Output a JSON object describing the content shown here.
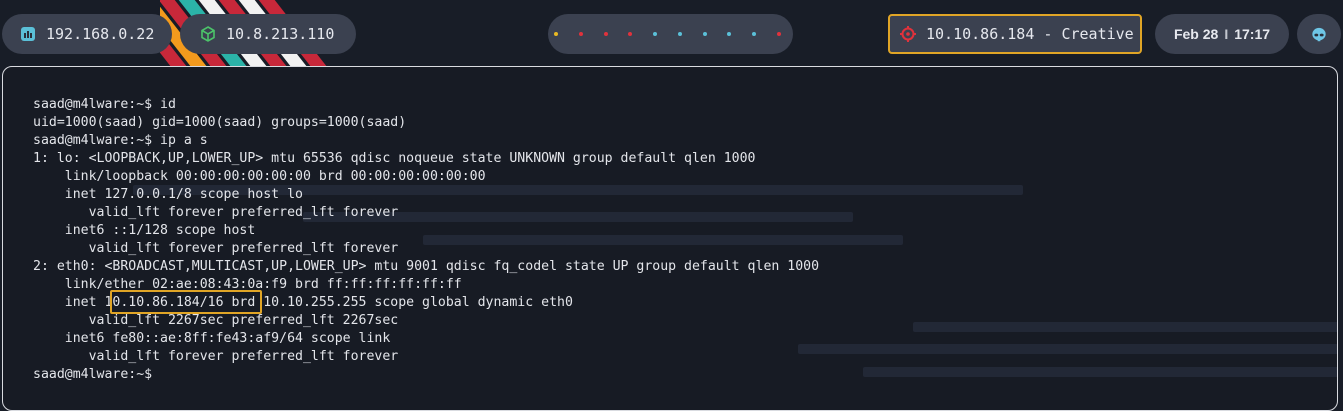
{
  "topbar": {
    "ip_local": "192.168.0.22",
    "ip_vpn": "10.8.213.110",
    "workspace_dots": [
      "#e8b923",
      "#e0323c",
      "#e0323c",
      "#e0323c",
      "#5bc0d8",
      "#5bc0d8",
      "#5bc0d8",
      "#5bc0d8",
      "#5bc0d8",
      "#e0323c"
    ],
    "target": "10.10.86.184 - Creative",
    "clock_date": "Feb 28",
    "clock_sep": "I",
    "clock_time": "17:17"
  },
  "terminal": {
    "lines": [
      "saad@m4lware:~$ id",
      "uid=1000(saad) gid=1000(saad) groups=1000(saad)",
      "saad@m4lware:~$ ip a s",
      "1: lo: <LOOPBACK,UP,LOWER_UP> mtu 65536 qdisc noqueue state UNKNOWN group default qlen 1000",
      "    link/loopback 00:00:00:00:00:00 brd 00:00:00:00:00:00",
      "    inet 127.0.0.1/8 scope host lo",
      "       valid_lft forever preferred_lft forever",
      "    inet6 ::1/128 scope host",
      "       valid_lft forever preferred_lft forever",
      "2: eth0: <BROADCAST,MULTICAST,UP,LOWER_UP> mtu 9001 qdisc fq_codel state UP group default qlen 1000",
      "    link/ether 02:ae:08:43:0a:f9 brd ff:ff:ff:ff:ff:ff",
      "    inet 10.10.86.184/16 brd 10.10.255.255 scope global dynamic eth0",
      "       valid_lft 2267sec preferred_lft 2267sec",
      "    inet6 fe80::ae:8ff:fe43:af9/64 scope link",
      "       valid_lft forever preferred_lft forever",
      "saad@m4lware:~$ "
    ]
  },
  "colors": {
    "accent": "#e0a526",
    "stripe_colors": [
      "#c8283a",
      "#f39a1d",
      "#c8283a",
      "#2bb3a8",
      "#f2f2f2",
      "#c8283a",
      "#f2f2f2",
      "#c8283a"
    ]
  }
}
